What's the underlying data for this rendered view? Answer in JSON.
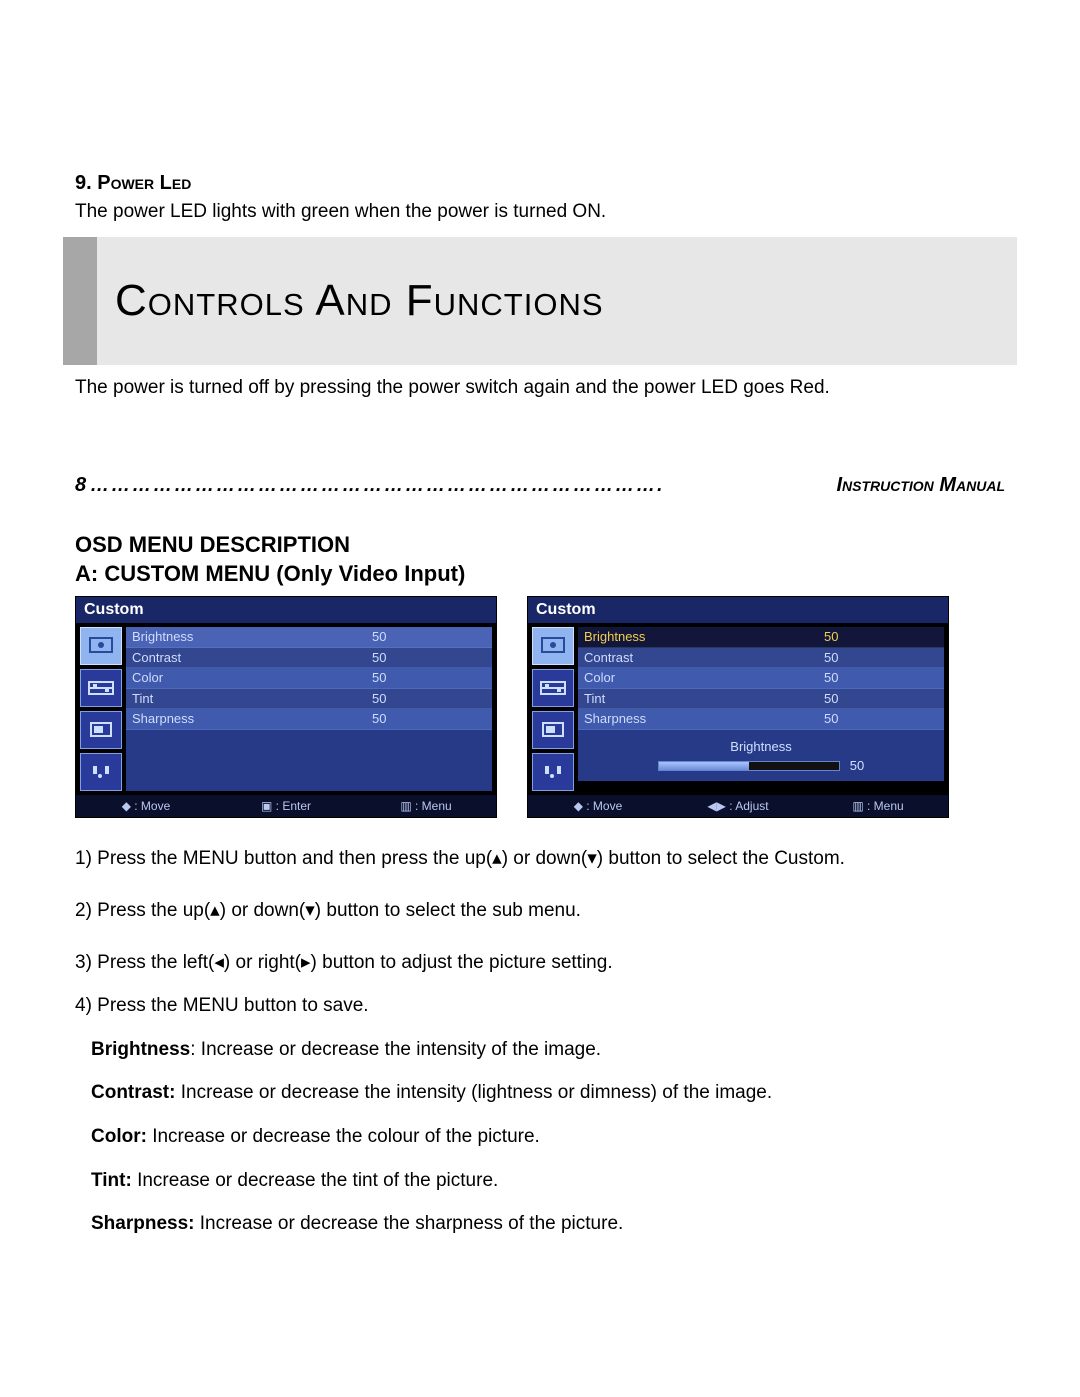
{
  "section9": {
    "title": "9. Power Led",
    "para1": "The power LED lights with green when the power is turned ON.",
    "para2": "The power is turned off by pressing the power switch again and the power LED goes Red."
  },
  "banner": {
    "title": "Controls And Functions"
  },
  "pageline": {
    "num": "8",
    "dots": "……………………………………………………………………….",
    "label": "Instruction Manual"
  },
  "osd_heading": {
    "line1": "OSD MENU DESCRIPTION",
    "line2": "A: CUSTOM MENU (Only Video Input)"
  },
  "osd": {
    "title": "Custom",
    "rows": [
      {
        "label": "Brightness",
        "value": "50"
      },
      {
        "label": "Contrast",
        "value": "50"
      },
      {
        "label": "Color",
        "value": "50"
      },
      {
        "label": "Tint",
        "value": "50"
      },
      {
        "label": "Sharpness",
        "value": "50"
      }
    ],
    "footer_left": {
      "move": "◆ : Move",
      "enter": "▣ : Enter",
      "menu": "▥ : Menu"
    },
    "footer_right": {
      "move": "◆ : Move",
      "adjust": "◀▶ : Adjust",
      "menu": "▥ : Menu"
    },
    "adjust": {
      "label": "Brightness",
      "value": "50",
      "percent": 50
    }
  },
  "steps": {
    "s1": "1) Press the MENU button and then press the up(▴) or down(▾) button to select the Custom.",
    "s2": "2) Press the up(▴) or down(▾) button to select the sub menu.",
    "s3": "3) Press the left(◂) or right(▸) button to adjust the picture setting.",
    "s4": "4) Press the MENU button to save."
  },
  "defs": {
    "brightness": {
      "term": "Brightness",
      "desc": ": Increase or decrease the intensity of the image."
    },
    "contrast": {
      "term": "Contrast:",
      "desc": " Increase or decrease the intensity (lightness or dimness) of the image."
    },
    "color": {
      "term": "Color:",
      "desc": " Increase or decrease the colour of the picture."
    },
    "tint": {
      "term": "Tint:",
      "desc": " Increase or decrease the tint of the picture."
    },
    "sharpness": {
      "term": "Sharpness:",
      "desc": " Increase or decrease the sharpness of the picture."
    }
  }
}
